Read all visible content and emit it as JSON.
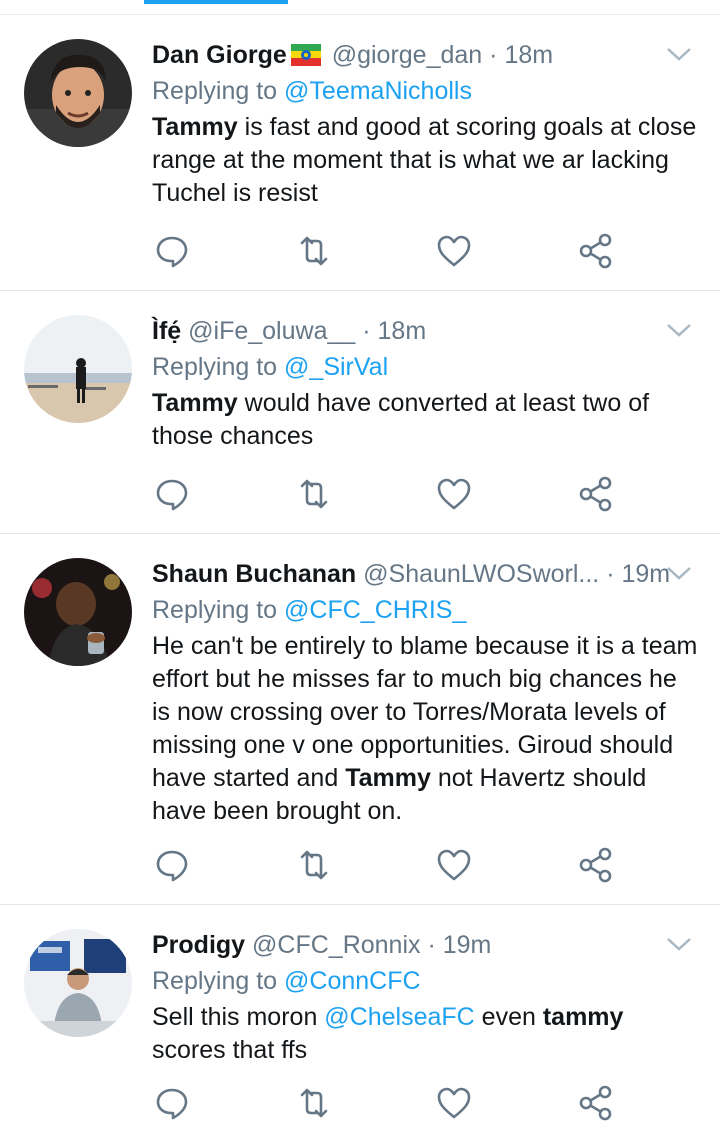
{
  "colors": {
    "accent": "#1da1f2",
    "muted": "#657786",
    "text": "#14171a"
  },
  "tweets": [
    {
      "name": "Dan Giorge",
      "handle": "@giorge_dan",
      "dot": "·",
      "time": "18m",
      "reply_prefix": "Replying to",
      "reply_to": "@TeemaNicholls",
      "body_bold": "Tammy",
      "body_rest": " is fast and good at scoring goals at close range at the moment that is what we ar lacking Tuchel is resist",
      "flag_icon": "ethiopia-flag-icon"
    },
    {
      "name": "Ìfẹ́",
      "handle": "@iFe_oluwa__",
      "dot": "·",
      "time": "18m",
      "reply_prefix": "Replying to",
      "reply_to": "@_SirVal",
      "body_bold": "Tammy",
      "body_rest": " would have converted at least two of those chances"
    },
    {
      "name": "Shaun Buchanan",
      "handle": "@ShaunLWOSworl...",
      "dot": "·",
      "time": "19m",
      "reply_prefix": "Replying to",
      "reply_to": "@CFC_CHRIS_",
      "body_pre": "He can't be entirely to blame because it is a team effort but he misses far to much big chances he is now crossing over to Torres/Morata levels of missing one v one opportunities. Giroud should have started and ",
      "body_bold": "Tammy",
      "body_post": " not Havertz should have been brought on."
    },
    {
      "name": "Prodigy",
      "handle": "@CFC_Ronnix",
      "dot": "·",
      "time": "19m",
      "reply_prefix": "Replying to",
      "reply_to": "@ConnCFC",
      "body_pre": "Sell this moron ",
      "body_mention": "@ChelseaFC",
      "body_mid": " even ",
      "body_bold": "tammy",
      "body_post": " scores that ffs"
    }
  ],
  "action_icons": [
    "reply-icon",
    "retweet-icon",
    "like-icon",
    "share-icon"
  ]
}
